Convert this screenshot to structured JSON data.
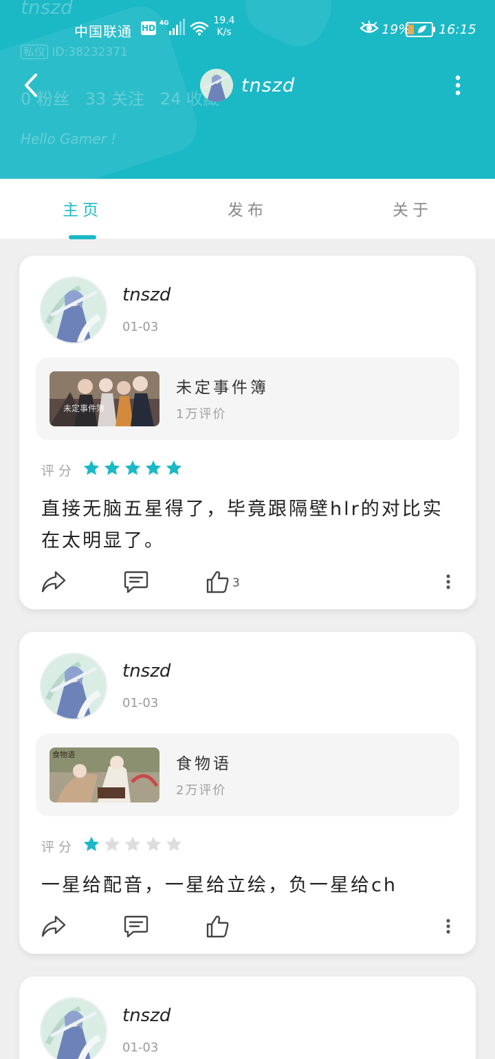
{
  "status_bar": {
    "carrier": "中国联通",
    "hd": "HD",
    "network": "4G",
    "speed_value": "19.4",
    "speed_unit": "K/s",
    "battery": "19%",
    "time": "16:15"
  },
  "header": {
    "title": "tnszd",
    "bg_ghost": {
      "name": "tnszd",
      "badge": "私仪",
      "id": "ID:38232371",
      "stats": "0 粉丝   33 关注   24 收藏",
      "tagline": "Hello Gamer !"
    },
    "colors": {
      "brand": "#1bb8c6",
      "star_on": "#1bb8c6",
      "star_off": "#dddddd"
    }
  },
  "tabs": [
    {
      "label": "主页",
      "active": true
    },
    {
      "label": "发布",
      "active": false
    },
    {
      "label": "关于",
      "active": false
    }
  ],
  "posts": [
    {
      "username": "tnszd",
      "date": "01-03",
      "game": {
        "name": "未定事件簿",
        "reviews": "1万评价",
        "thumb_text": "未定事件簿"
      },
      "rating_label": "评分",
      "rating": 5,
      "text": "直接无脑五星得了，毕竟跟隔壁hlr的对比实在太明显了。",
      "likes": "3"
    },
    {
      "username": "tnszd",
      "date": "01-03",
      "game": {
        "name": "食物语",
        "reviews": "2万评价",
        "thumb_text": "食物语"
      },
      "rating_label": "评分",
      "rating": 1,
      "text": "一星给配音，一星给立绘，负一星给ch",
      "likes": ""
    },
    {
      "username": "tnszd",
      "date": "01-03"
    }
  ]
}
